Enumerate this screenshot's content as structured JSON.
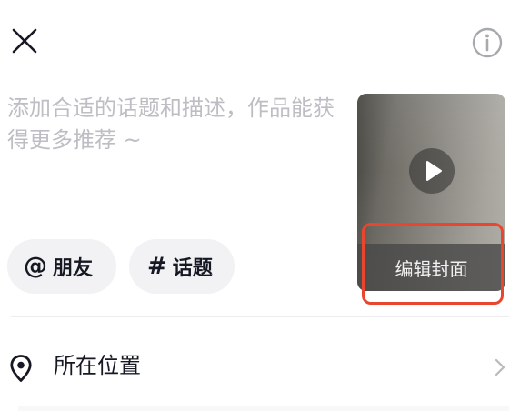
{
  "header": {
    "close_icon": "close-icon",
    "info_icon": "info-icon"
  },
  "description": {
    "value": "",
    "placeholder": "添加合适的话题和描述，作品能获得更多推荐 ~"
  },
  "chips": {
    "friends": {
      "symbol": "@",
      "label": "朋友"
    },
    "topic": {
      "symbol": "#",
      "label": "话题"
    }
  },
  "cover": {
    "play_icon": "play-icon",
    "edit_label": "编辑封面",
    "highlight_color": "#e8462f"
  },
  "location": {
    "icon": "location-pin-icon",
    "label": "所在位置",
    "chevron_icon": "chevron-right-icon"
  }
}
